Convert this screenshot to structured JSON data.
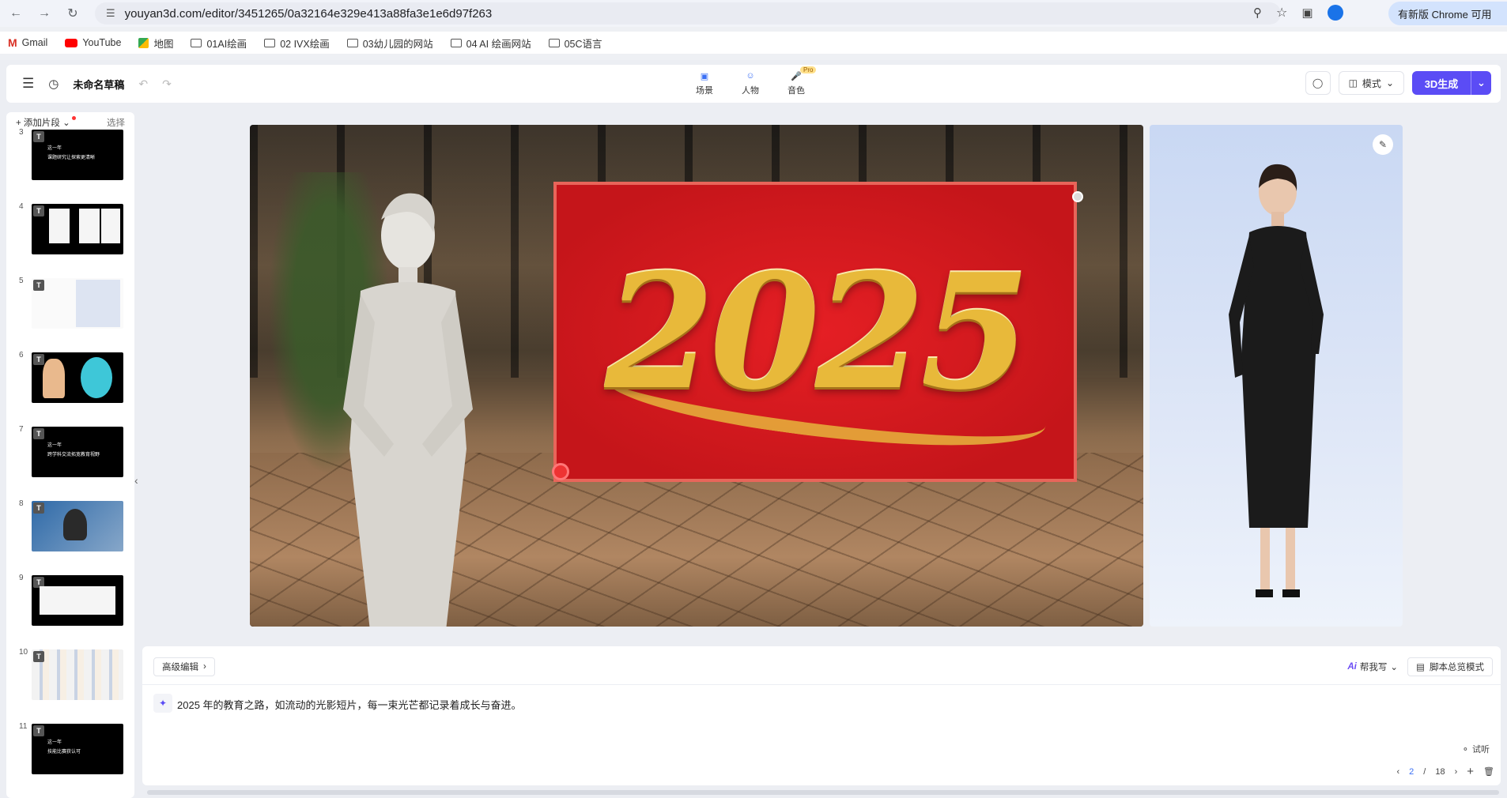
{
  "browser": {
    "url": "youyan3d.com/editor/3451265/0a32164e329e413a88fa3e1e6d97f263",
    "update_label": "有新版 Chrome 可用",
    "bookmarks": [
      {
        "label": "Gmail",
        "icon": "gmail-icon"
      },
      {
        "label": "YouTube",
        "icon": "youtube-icon"
      },
      {
        "label": "地图",
        "icon": "maps-icon"
      },
      {
        "label": "01AI绘画",
        "icon": "folder-icon"
      },
      {
        "label": "02 IVX绘画",
        "icon": "folder-icon"
      },
      {
        "label": "03幼儿园的网站",
        "icon": "folder-icon"
      },
      {
        "label": "04 AI 绘画网站",
        "icon": "folder-icon"
      },
      {
        "label": "05C语言",
        "icon": "folder-icon"
      }
    ]
  },
  "header": {
    "title": "未命名草稿",
    "tools": [
      {
        "label": "场景",
        "icon": "scene-icon"
      },
      {
        "label": "人物",
        "icon": "person-icon"
      },
      {
        "label": "音色",
        "icon": "voice-icon",
        "badge": "Pro"
      }
    ],
    "mode_label": "模式",
    "generate_label": "3D生成",
    "accent": "#5b4cf5"
  },
  "slides_panel": {
    "add_label": "添加片段",
    "select_label": "选择",
    "slides": [
      {
        "num": "3",
        "badge": "T",
        "line1": "这一年",
        "line2": "课题研究让探索更清晰"
      },
      {
        "num": "4",
        "badge": "T",
        "line1": "",
        "line2": ""
      },
      {
        "num": "5",
        "badge": "T",
        "line1": "",
        "line2": ""
      },
      {
        "num": "6",
        "badge": "T",
        "line1": "",
        "line2": ""
      },
      {
        "num": "7",
        "badge": "T",
        "line1": "这一年",
        "line2": "跨学科交流拓宽教育视野"
      },
      {
        "num": "8",
        "badge": "T",
        "line1": "",
        "line2": ""
      },
      {
        "num": "9",
        "badge": "T",
        "line1": "",
        "line2": ""
      },
      {
        "num": "10",
        "badge": "T",
        "line1": "",
        "line2": ""
      },
      {
        "num": "11",
        "badge": "T",
        "line1": "这一年",
        "line2": "技能比赛获认可"
      }
    ]
  },
  "stage": {
    "banner_text": "2025"
  },
  "script": {
    "advanced_label": "高级编辑",
    "help_label": "帮我写",
    "overview_label": "脚本总览模式",
    "text": "2025 年的教育之路，如流动的光影短片，每一束光芒都记录着成长与奋进。",
    "tryout_label": "试听",
    "page_current": "2",
    "page_sep": "/",
    "page_total": "18"
  }
}
